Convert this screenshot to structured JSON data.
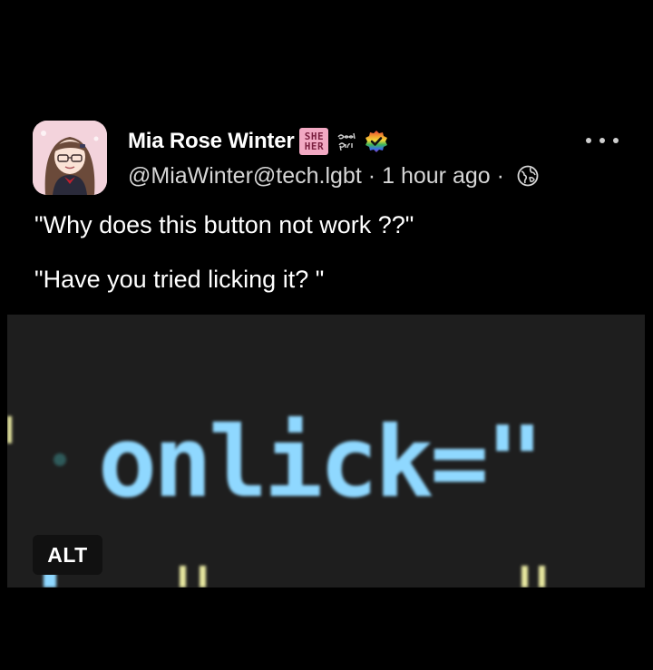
{
  "post": {
    "author": {
      "display_name": "Mia Rose Winter",
      "handle": "@MiaWinter@tech.lgbt",
      "emoji": [
        {
          "name": "she-her-pronoun-emoji",
          "lines": [
            "SHE",
            "HER"
          ]
        },
        {
          "name": "good-girl-emoji",
          "text": "Good girl"
        },
        {
          "name": "rainbow-verified-emoji"
        }
      ]
    },
    "timestamp": "1 hour ago",
    "separator": "·",
    "visibility_icon": "globe-icon",
    "more_icon": "ellipsis-icon",
    "content": {
      "line1": "\"Why does this button not work ??\"",
      "line2": "\"Have you tried licking it? \""
    },
    "media": {
      "code_text": "onlick=\"",
      "alt_label": "ALT"
    }
  },
  "colors": {
    "background": "#000000",
    "text": "#ffffff",
    "secondary_text": "#d6d6d6",
    "code_background": "#1e1e1e",
    "code_keyword": "#8fd8ff",
    "code_string": "#e8e8a0",
    "pronoun_badge": "#f2a9c3"
  }
}
